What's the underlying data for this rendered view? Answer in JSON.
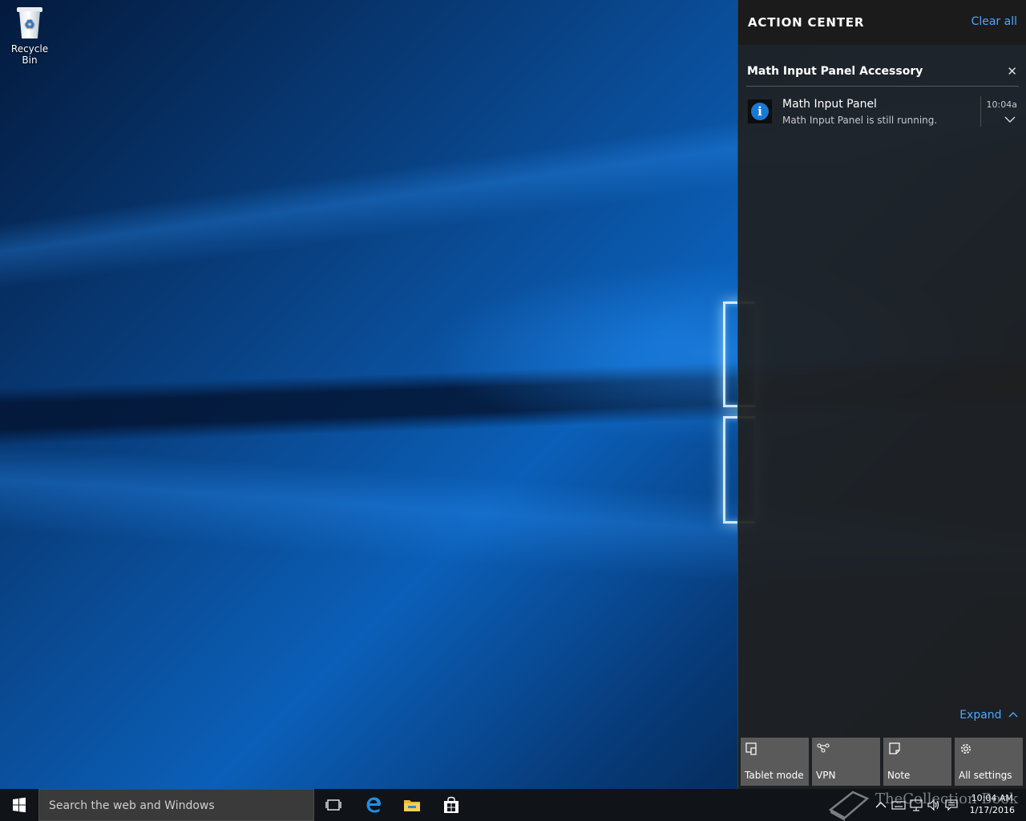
{
  "desktop": {
    "icons": [
      {
        "label": "Recycle Bin",
        "icon": "recycle-bin-icon"
      }
    ]
  },
  "action_center": {
    "title": "ACTION CENTER",
    "clear_all": "Clear all",
    "group": {
      "title": "Math Input Panel Accessory",
      "close_icon": "close-icon"
    },
    "notification": {
      "icon": "info-icon",
      "title": "Math Input Panel",
      "body": "Math Input Panel is still running.",
      "time": "10:04a",
      "expand_icon": "chevron-down-icon"
    },
    "expand_label": "Expand",
    "quick_actions": [
      {
        "label": "Tablet mode",
        "icon": "tablet-mode-icon"
      },
      {
        "label": "VPN",
        "icon": "vpn-icon"
      },
      {
        "label": "Note",
        "icon": "note-icon"
      },
      {
        "label": "All settings",
        "icon": "gear-icon"
      }
    ]
  },
  "taskbar": {
    "search_placeholder": "Search the web and Windows",
    "pinned": [
      "task-view-icon",
      "edge-icon",
      "file-explorer-icon",
      "store-icon"
    ],
    "tray": [
      "chevron-up-icon",
      "keyboard-icon",
      "network-icon",
      "volume-icon",
      "notifications-icon"
    ],
    "clock": {
      "time": "10:04 AM",
      "date": "1/17/2016"
    }
  },
  "watermark": {
    "text": "TheCollection Book"
  },
  "colors": {
    "accent": "#4ea6ff",
    "panel": "#1f1f1f",
    "tile": "#5a5a5a",
    "taskbar": "#101418"
  }
}
